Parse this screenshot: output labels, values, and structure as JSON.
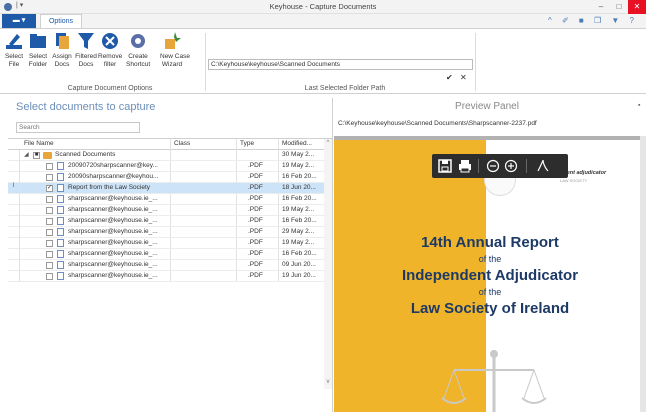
{
  "window": {
    "title": "Keyhouse - Capture Documents",
    "min": "–",
    "max": "□",
    "close": "✕"
  },
  "tabs": {
    "file": "▬ ▾",
    "options": "Options"
  },
  "ribbon": {
    "buttons": [
      {
        "label1": "Select",
        "label2": "File"
      },
      {
        "label1": "Select",
        "label2": "Folder"
      },
      {
        "label1": "Assign",
        "label2": "Docs"
      },
      {
        "label1": "Filtered",
        "label2": "Docs"
      },
      {
        "label1": "Remove",
        "label2": "filter"
      },
      {
        "label1": "Create",
        "label2": "Shortcut"
      },
      {
        "label1": "New Case",
        "label2": "Wizard"
      }
    ],
    "group1_label": "Capture Document Options",
    "group2_label": "Last Selected Folder Path",
    "path_value": "C:\\Keyhouse\\keyhouse\\Scanned Documents",
    "ok": "✔",
    "cancel": "✕"
  },
  "left_pane": {
    "title": "Select documents to capture",
    "search_placeholder": "Search",
    "columns": [
      "File Name",
      "Class",
      "Type",
      "Modified..."
    ],
    "rows": [
      {
        "name": "Scanned Documents",
        "class": "",
        "type": "",
        "modified": "30 May 2...",
        "folder": true,
        "checked": false,
        "partial": true
      },
      {
        "name": "20090720sharpscanner@key...",
        "class": "",
        "type": ".PDF",
        "modified": "19 May 2...",
        "folder": false,
        "checked": false
      },
      {
        "name": "20090sharpscanner@keyhou...",
        "class": "",
        "type": ".PDF",
        "modified": "16 Feb 20...",
        "folder": false,
        "checked": false
      },
      {
        "name": "Report from the Law Society",
        "class": "",
        "type": ".PDF",
        "modified": "18 Jun 20...",
        "folder": false,
        "checked": true,
        "selected": true
      },
      {
        "name": "sharpscanner@keyhouse.ie_...",
        "class": "",
        "type": ".PDF",
        "modified": "16 Feb 20...",
        "folder": false,
        "checked": false
      },
      {
        "name": "sharpscanner@keyhouse.ie_...",
        "class": "",
        "type": ".PDF",
        "modified": "19 May 2...",
        "folder": false,
        "checked": false
      },
      {
        "name": "sharpscanner@keyhouse.ie_...",
        "class": "",
        "type": ".PDF",
        "modified": "16 Feb 20...",
        "folder": false,
        "checked": false
      },
      {
        "name": "sharpscanner@keyhouse.ie_...",
        "class": "",
        "type": ".PDF",
        "modified": "29 May 2...",
        "folder": false,
        "checked": false
      },
      {
        "name": "sharpscanner@keyhouse.ie_...",
        "class": "",
        "type": ".PDF",
        "modified": "19 May 2...",
        "folder": false,
        "checked": false
      },
      {
        "name": "sharpscanner@keyhouse.ie_...",
        "class": "",
        "type": ".PDF",
        "modified": "16 Feb 20...",
        "folder": false,
        "checked": false
      },
      {
        "name": "sharpscanner@keyhouse.ie_...",
        "class": "",
        "type": ".PDF",
        "modified": "09 Jun 20...",
        "folder": false,
        "checked": false
      },
      {
        "name": "sharpscanner@keyhouse.ie_...",
        "class": "",
        "type": ".PDF",
        "modified": "19 Jun 20...",
        "folder": false,
        "checked": false
      }
    ]
  },
  "preview": {
    "title": "Preview Panel",
    "path": "C:\\Keyhouse\\keyhouse\\Scanned Documents\\Sharpscanner-2237.pdf",
    "adjudicator_heading": "ndent adjudicator",
    "adjudicator_sub": "LAW SOCIETY",
    "report_line1": "14th Annual Report",
    "report_line2": "of the",
    "report_line3": "Independent Adjudicator",
    "report_line4": "of the",
    "report_line5": "Law Society of Ireland"
  },
  "colors": {
    "accent": "#1e5aa8",
    "selection": "#cde3f7",
    "page_band": "#f0b42b",
    "report_text": "#1d3a66"
  }
}
